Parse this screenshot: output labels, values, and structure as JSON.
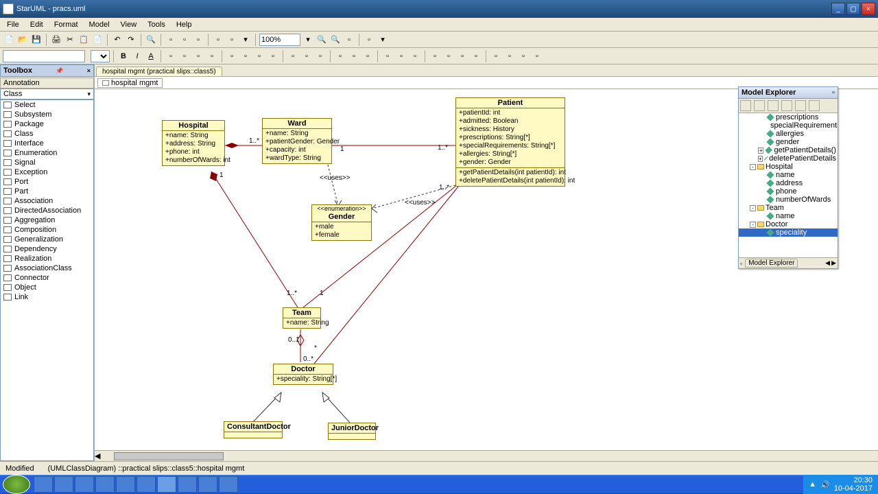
{
  "window": {
    "title": "StarUML - pracs.uml"
  },
  "menu": [
    "File",
    "Edit",
    "Format",
    "Model",
    "View",
    "Tools",
    "Help"
  ],
  "zoom": "100%",
  "tabstrip": {
    "main": "hospital mgmt (practical slips::class5)",
    "sub": "hospital mgmt"
  },
  "toolbox": {
    "title": "Toolbox",
    "section": "Annotation",
    "category": "Class",
    "items": [
      "Select",
      "Subsystem",
      "Package",
      "Class",
      "Interface",
      "Enumeration",
      "Signal",
      "Exception",
      "Port",
      "Part",
      "Association",
      "DirectedAssociation",
      "Aggregation",
      "Composition",
      "Generalization",
      "Dependency",
      "Realization",
      "AssociationClass",
      "Connector",
      "Object",
      "Link"
    ]
  },
  "classes": {
    "hospital": {
      "name": "Hospital",
      "attrs": [
        "+name: String",
        "+address: String",
        "+phone: int",
        "+numberOfWards: int"
      ]
    },
    "ward": {
      "name": "Ward",
      "attrs": [
        "+name: String",
        "+patientGender: Gender",
        "+capacity: int",
        "+wardType: String"
      ]
    },
    "patient": {
      "name": "Patient",
      "attrs": [
        "+patientId: int",
        "+admitted: Boolean",
        "+sickness: History",
        "+prescriptions: String[*]",
        "+specialRequirements: String[*]",
        "+allergies: String[*]",
        "+gender: Gender"
      ],
      "ops": [
        "+getPatientDetails(int patientId): int",
        "+deletePatientDetails(int patientId): int"
      ]
    },
    "gender": {
      "name": "Gender",
      "stereo": "<<enumeration>>",
      "attrs": [
        "+male",
        "+female"
      ]
    },
    "team": {
      "name": "Team",
      "attrs": [
        "+name: String"
      ]
    },
    "doctor": {
      "name": "Doctor",
      "attrs": [
        "+speciality: String[*]"
      ]
    },
    "consultant": {
      "name": "ConsultantDoctor"
    },
    "junior": {
      "name": "JuniorDoctor"
    }
  },
  "mults": {
    "m1": "1",
    "m2": "1..*",
    "m3": "1",
    "m4": "1..*",
    "m5": "1",
    "m6": "1..*",
    "m7": "1..*",
    "m8": "1",
    "m9": "0..1",
    "m10": "*",
    "m11": "0..*"
  },
  "uses": {
    "u1": "<<uses>>",
    "u2": "<<uses>>"
  },
  "modelExplorer": {
    "title": "Model Explorer",
    "nodes": [
      {
        "indent": 40,
        "icon": "di",
        "label": "prescriptions"
      },
      {
        "indent": 40,
        "icon": "di",
        "label": "specialRequirements"
      },
      {
        "indent": 40,
        "icon": "di",
        "label": "allergies"
      },
      {
        "indent": 40,
        "icon": "di",
        "label": "gender"
      },
      {
        "indent": 28,
        "exp": "+",
        "icon": "di",
        "label": "getPatientDetails()"
      },
      {
        "indent": 28,
        "exp": "+",
        "icon": "di",
        "label": "deletePatientDetails"
      },
      {
        "indent": 16,
        "exp": "-",
        "icon": "fo",
        "label": "Hospital"
      },
      {
        "indent": 40,
        "icon": "di",
        "label": "name"
      },
      {
        "indent": 40,
        "icon": "di",
        "label": "address"
      },
      {
        "indent": 40,
        "icon": "di",
        "label": "phone"
      },
      {
        "indent": 40,
        "icon": "di",
        "label": "numberOfWards"
      },
      {
        "indent": 16,
        "exp": "-",
        "icon": "fo",
        "label": "Team"
      },
      {
        "indent": 40,
        "icon": "di",
        "label": "name"
      },
      {
        "indent": 16,
        "exp": "-",
        "icon": "fo",
        "label": "Doctor"
      },
      {
        "indent": 40,
        "icon": "di",
        "label": "speciality",
        "sel": true
      }
    ],
    "bottomTab": "Model Explorer"
  },
  "status": {
    "modified": "Modified",
    "path": "(UMLClassDiagram) ::practical slips::class5::hospital mgmt"
  },
  "tray": {
    "time": "20:30",
    "date": "10-04-2017"
  }
}
